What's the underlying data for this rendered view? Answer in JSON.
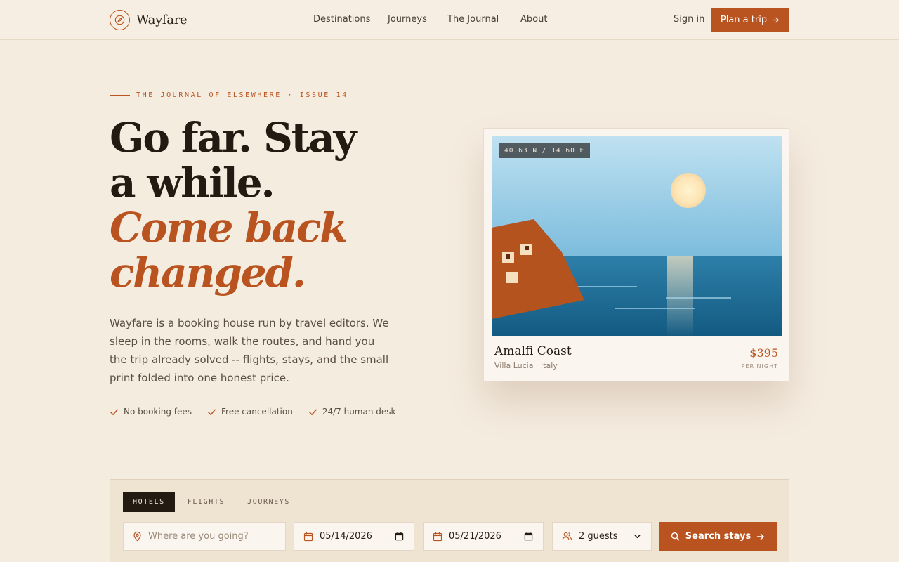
{
  "brand": {
    "name": "Wayfare",
    "icon": "compass-icon"
  },
  "nav": {
    "links": [
      "Destinations",
      "Journeys",
      "The Journal",
      "About"
    ],
    "sign_in": "Sign in",
    "cta": "Plan a trip"
  },
  "hero": {
    "eyebrow": "THE JOURNAL OF ELSEWHERE · ISSUE 14",
    "headline_1": "Go far. Stay",
    "headline_2": "a while.",
    "headline_accent_1": "Come back",
    "headline_accent_2": "changed.",
    "lede": "Wayfare is a booking house run by travel editors. We sleep in the rooms, walk the routes, and hand you the trip already solved -- flights, stays, and the small print folded into one honest price.",
    "perks": [
      "No booking fees",
      "Free cancellation",
      "24/7 human desk"
    ]
  },
  "card": {
    "coords": "40.63 N / 14.60 E",
    "title": "Amalfi Coast",
    "subtitle": "Villa Lucia · Italy",
    "price": "$395",
    "unit": "PER NIGHT"
  },
  "search": {
    "tabs": [
      "HOTELS",
      "FLIGHTS",
      "JOURNEYS"
    ],
    "active_tab": "HOTELS",
    "destination_placeholder": "Where are you going?",
    "check_in": "05/14/2026",
    "check_out": "05/21/2026",
    "guests": "2 guests",
    "submit": "Search stays"
  },
  "colors": {
    "accent": "#b9531f",
    "background": "#f5ece0",
    "ink": "#231a12"
  }
}
